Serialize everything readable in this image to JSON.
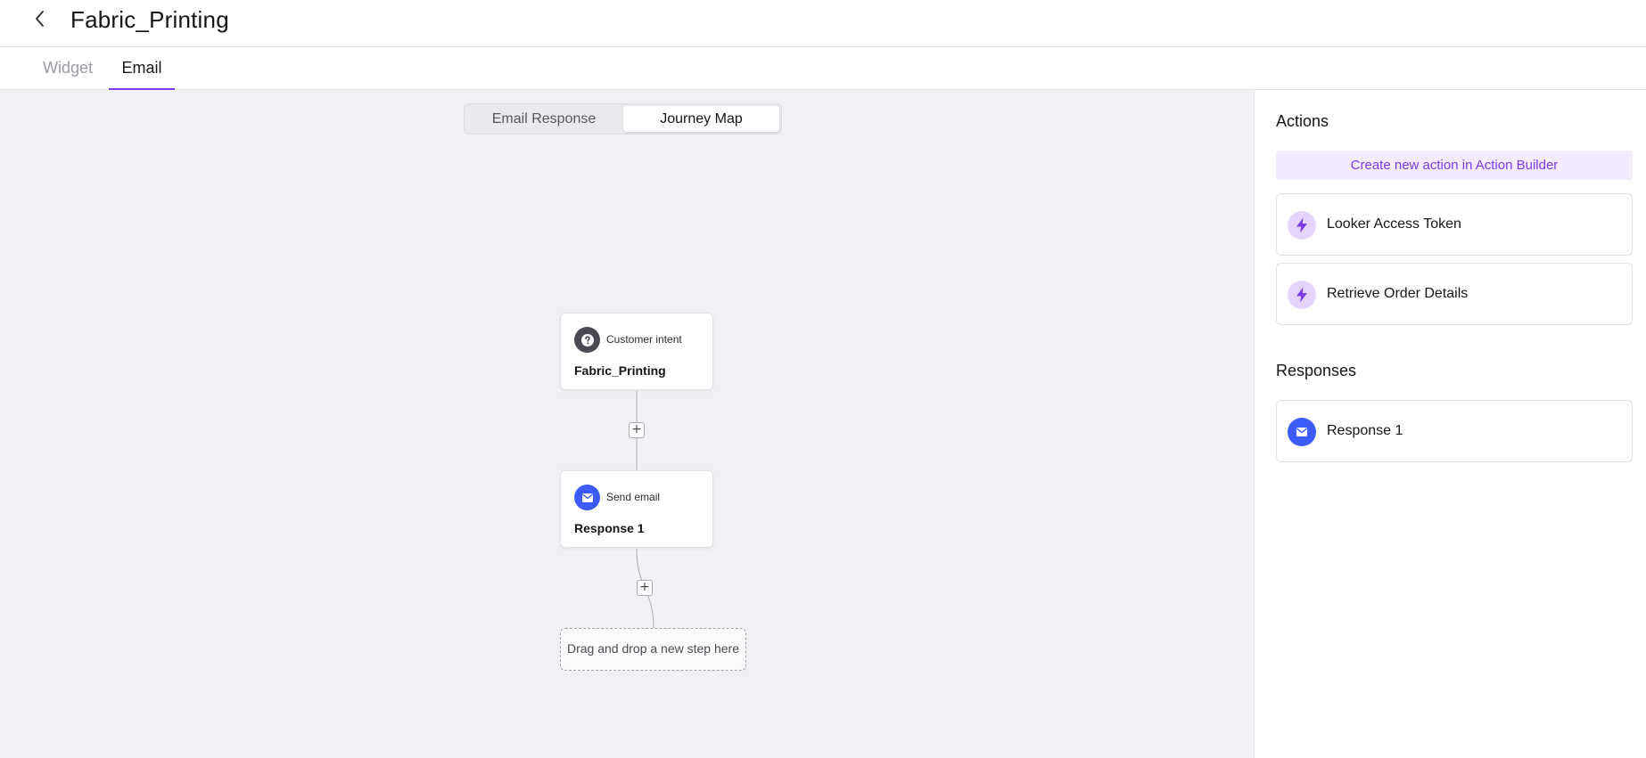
{
  "header": {
    "title": "Fabric_Printing",
    "back_icon": "chevron-left-icon"
  },
  "tabs": [
    {
      "label": "Widget",
      "active": false
    },
    {
      "label": "Email",
      "active": true
    }
  ],
  "canvas": {
    "view_toggle": {
      "options": [
        "Email Response",
        "Journey Map"
      ],
      "selected": "Journey Map"
    },
    "nodes": [
      {
        "type": "Customer intent",
        "name": "Fabric_Printing",
        "icon": "question-circle-icon"
      },
      {
        "type": "Send email",
        "name": "Response 1",
        "icon": "mail-icon"
      }
    ],
    "add_step_symbol": "+",
    "dropzone_text": "Drag and drop a new step here"
  },
  "panel": {
    "actions_heading": "Actions",
    "create_action_label": "Create new action in Action Builder",
    "actions": [
      {
        "label": "Looker Access Token",
        "icon": "lightning-icon"
      },
      {
        "label": "Retrieve Order Details",
        "icon": "lightning-icon"
      }
    ],
    "responses_heading": "Responses",
    "responses": [
      {
        "label": "Response 1",
        "icon": "mail-icon"
      }
    ]
  },
  "colors": {
    "accent": "#7c3aed",
    "accent_bg": "#f4ecfe",
    "email_blue": "#3b5bfd",
    "canvas_bg": "#f0f1f5"
  }
}
